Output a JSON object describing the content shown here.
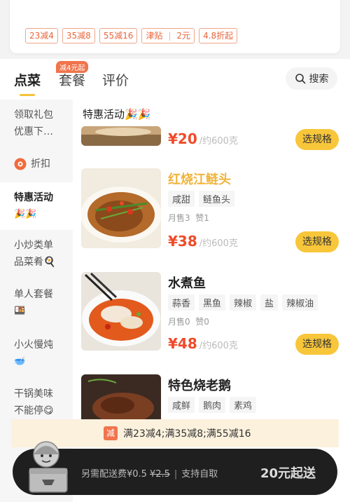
{
  "promo": {
    "tags": [
      "23减4",
      "35减8",
      "55减16"
    ],
    "subsidy": {
      "label": "津贴",
      "value": "2元"
    },
    "discount": "4.8折起"
  },
  "tabs": {
    "items": [
      "点菜",
      "套餐",
      "评价"
    ],
    "active": "点菜",
    "badge": "减4元起",
    "search_label": "搜索"
  },
  "sidebar": {
    "items": [
      {
        "line1": "领取礼包",
        "line2": "优惠下…"
      },
      {
        "label": "折扣",
        "icon": "discount-icon"
      },
      {
        "line1": "特惠活动",
        "line2": "🎉🎉",
        "active": true
      },
      {
        "line1": "小炒类单",
        "line2": "品菜肴🍳"
      },
      {
        "line1": "单人套餐",
        "line2": "🍱"
      },
      {
        "line1": "小火慢炖",
        "line2": "🥣"
      },
      {
        "line1": "干锅美味",
        "line2": "不能停😋"
      }
    ]
  },
  "section": {
    "title": "特惠活动🎉🎉"
  },
  "dishes": [
    {
      "price": "¥20",
      "unit": "/约600克",
      "button": "选规格"
    },
    {
      "name": "红烧江鲢头",
      "tags": [
        "咸甜",
        "鲢鱼头"
      ],
      "sales": "月售3",
      "likes": "赞1",
      "price": "¥38",
      "unit": "/约600克",
      "button": "选规格"
    },
    {
      "name": "水煮鱼",
      "tags": [
        "蒜香",
        "黑鱼",
        "辣椒",
        "盐",
        "辣椒油"
      ],
      "sales": "月售0",
      "likes": "赞0",
      "price": "¥48",
      "unit": "/约600克",
      "button": "选规格"
    },
    {
      "name": "特色烧老鹅",
      "tags": [
        "咸鲜",
        "鹅肉",
        "素鸡"
      ]
    }
  ],
  "discount_bar": {
    "badge": "减",
    "text": "满23减4;满35减8;满55减16"
  },
  "cart": {
    "fee_label": "另需配送费¥0.5",
    "fee_original": "¥2.5",
    "pickup": "支持自取",
    "min_order": "20元起送"
  },
  "colors": {
    "accent": "#f8c63a",
    "price": "#f04b2a",
    "promo": "#e8663c"
  }
}
